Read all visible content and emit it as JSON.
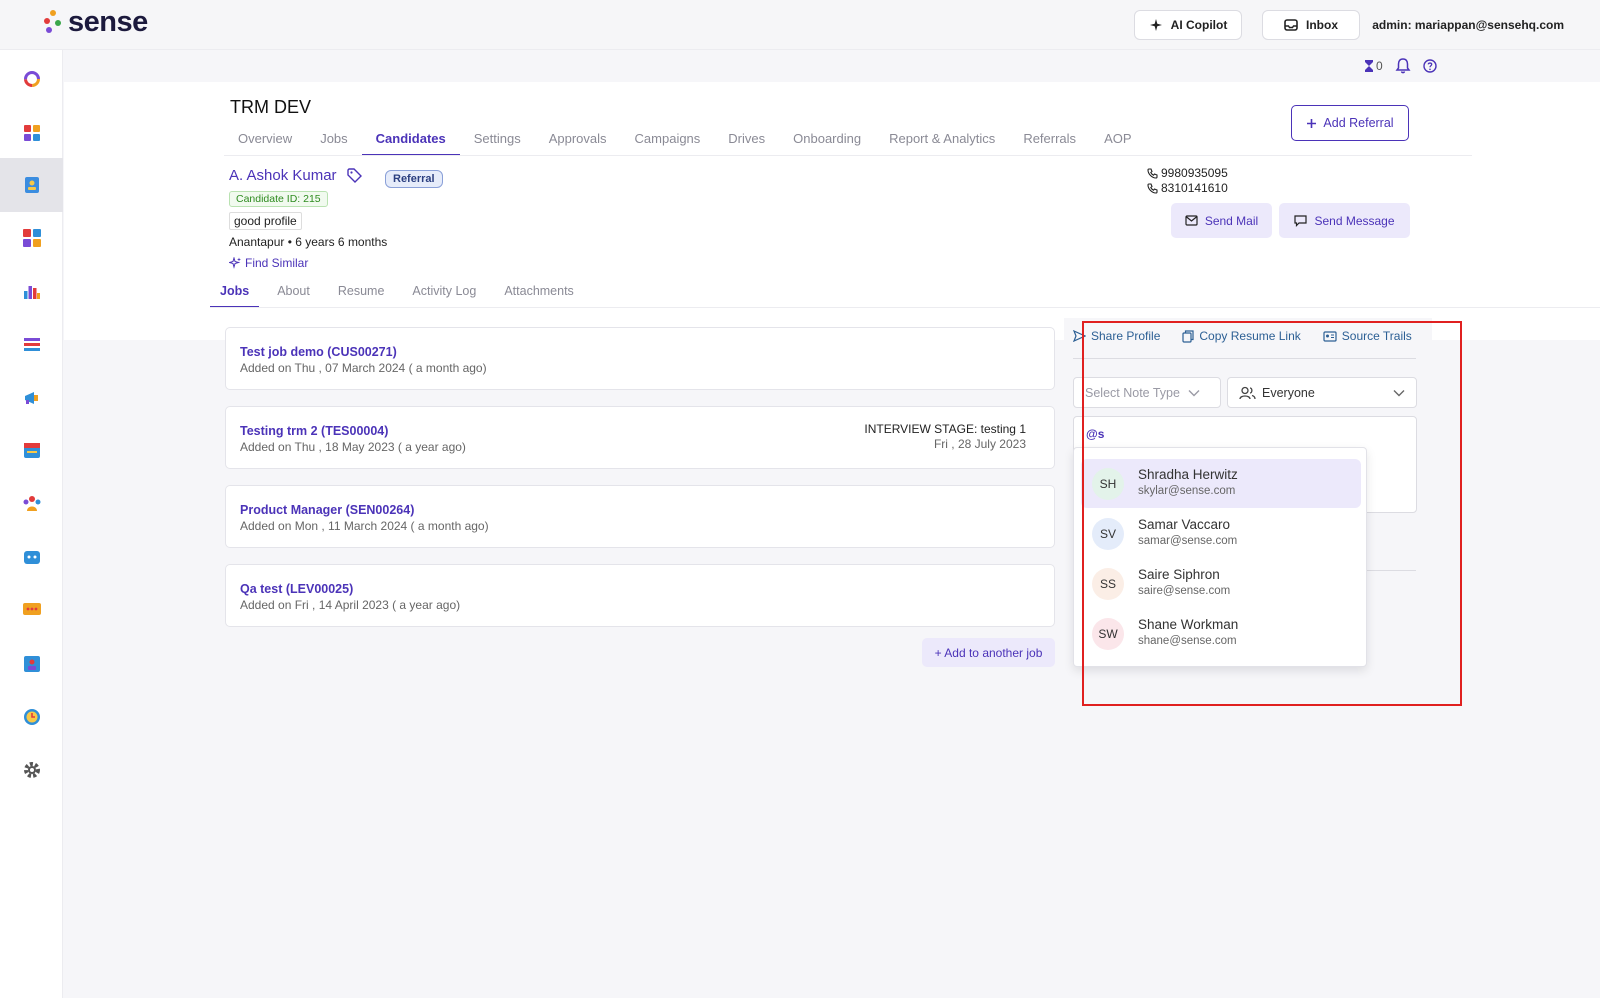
{
  "brand": {
    "name": "sense"
  },
  "topbar": {
    "ai_copilot": "AI Copilot",
    "inbox": "Inbox",
    "admin": "admin: mariappan@sensehq.com",
    "counter": "0"
  },
  "sidebar": {
    "items": [
      "dashboard",
      "apps",
      "candidates",
      "integrations",
      "reports",
      "lists",
      "campaigns",
      "calendar",
      "teams",
      "bots",
      "messages",
      "contacts",
      "scheduler",
      "settings"
    ]
  },
  "project": {
    "title": "TRM DEV",
    "tabs": [
      "Overview",
      "Jobs",
      "Candidates",
      "Settings",
      "Approvals",
      "Campaigns",
      "Drives",
      "Onboarding",
      "Report & Analytics",
      "Referrals",
      "AOP"
    ],
    "active_tab": "Candidates",
    "add_referral": "Add Referral"
  },
  "candidate": {
    "name": "A. Ashok Kumar",
    "badge": "Referral",
    "id_label": "Candidate ID: 215",
    "tag": "good profile",
    "location": "Anantapur • 6 years 6 months",
    "find_similar": "Find Similar",
    "phones": [
      "9980935095",
      "8310141610"
    ],
    "send_mail": "Send Mail",
    "send_message": "Send Message"
  },
  "candidate_tabs": [
    "Jobs",
    "About",
    "Resume",
    "Activity Log",
    "Attachments"
  ],
  "jobs": [
    {
      "title": "Test job demo (CUS00271)",
      "added": "Added on Thu , 07 March 2024 ( a month ago)",
      "stage": "",
      "stage_date": ""
    },
    {
      "title": "Testing trm 2 (TES00004)",
      "added": "Added on Thu , 18 May 2023 ( a year ago)",
      "stage": "INTERVIEW STAGE: testing 1",
      "stage_date": "Fri , 28 July 2023"
    },
    {
      "title": "Product Manager (SEN00264)",
      "added": "Added on Mon , 11 March 2024 ( a month ago)",
      "stage": "",
      "stage_date": ""
    },
    {
      "title": "Qa test (LEV00025)",
      "added": "Added on Fri , 14 April 2023 ( a year ago)",
      "stage": "",
      "stage_date": ""
    }
  ],
  "add_job": "+ Add to another job",
  "panel": {
    "share_profile": "Share Profile",
    "copy_resume": "Copy Resume Link",
    "source_trails": "Source Trails",
    "note_type_placeholder": "Select Note Type",
    "visibility": "Everyone",
    "note_text": "@s"
  },
  "mentions": [
    {
      "initials": "SH",
      "name": "Shradha Herwitz",
      "email": "skylar@sense.com",
      "color": "#e3f3ea"
    },
    {
      "initials": "SV",
      "name": "Samar Vaccaro",
      "email": "samar@sense.com",
      "color": "#e4ecfa"
    },
    {
      "initials": "SS",
      "name": "Saire Siphron",
      "email": "saire@sense.com",
      "color": "#fbeee6"
    },
    {
      "initials": "SW",
      "name": "Shane Workman",
      "email": "shane@sense.com",
      "color": "#fbe6ea"
    }
  ],
  "colors": {
    "accent": "#4b33b8",
    "highlight": "#e02020"
  }
}
